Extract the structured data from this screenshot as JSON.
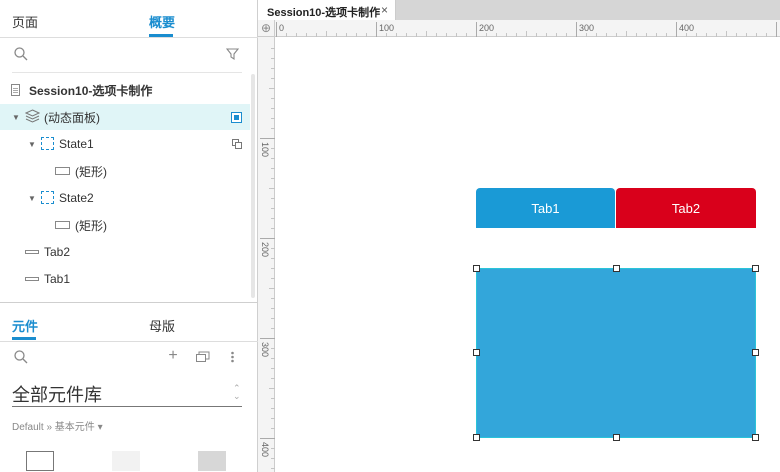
{
  "left_panel": {
    "tabs": [
      "页面",
      "概要"
    ],
    "outline": {
      "page_name": "Session10-选项卡制作",
      "items": [
        {
          "label": "(动态面板)"
        },
        {
          "label": "State1"
        },
        {
          "label": "(矩形)"
        },
        {
          "label": "State2"
        },
        {
          "label": "(矩形)"
        },
        {
          "label": "Tab2"
        },
        {
          "label": "Tab1"
        }
      ]
    },
    "bottom_tabs": [
      "元件",
      "母版"
    ],
    "library": {
      "title": "全部元件库",
      "breadcrumb": "Default » 基本元件 ▾"
    }
  },
  "doc_tab": {
    "title": "Session10-选项卡制作",
    "close": "×"
  },
  "ruler": {
    "h_labels": [
      "0",
      "100",
      "200",
      "300",
      "400"
    ],
    "v_labels": [
      "100",
      "200",
      "300",
      "400"
    ]
  },
  "canvas": {
    "tab1_label": "Tab1",
    "tab2_label": "Tab2",
    "colors": {
      "tab1": "#1a9ad6",
      "tab2": "#d9001b",
      "panel": "#33a6da",
      "accent": "#1a8dcf"
    }
  }
}
